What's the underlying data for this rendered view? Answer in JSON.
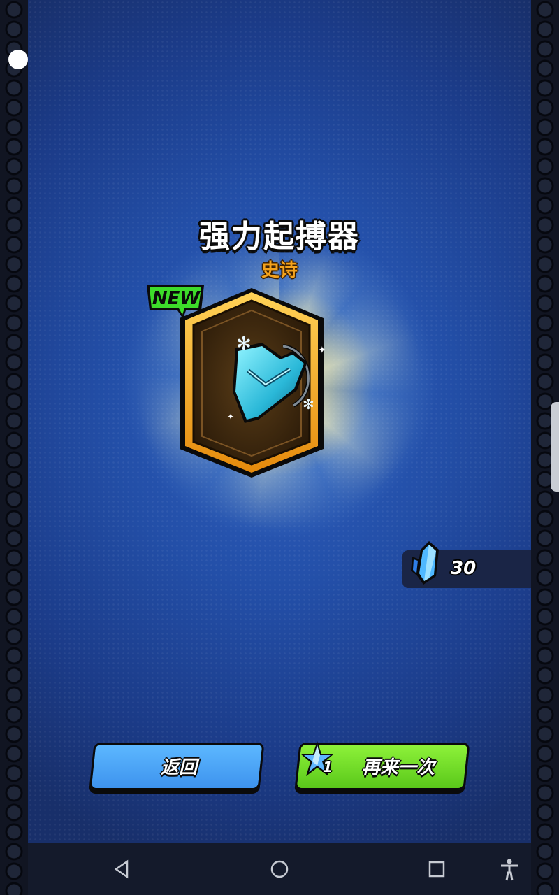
{
  "item": {
    "name": "强力起搏器",
    "rarity": "史诗",
    "badge": "NEW",
    "icon": "heart-pacemaker-icon"
  },
  "currency": {
    "icon": "blue-crystal-icon",
    "amount": "30"
  },
  "buttons": {
    "back_label": "返回",
    "again_label": "再来一次",
    "again_cost": "1",
    "again_cost_icon": "star-ticket-icon"
  },
  "colors": {
    "rarity": "#f4a21b",
    "back_button": "#4aa5f5",
    "again_button": "#72dc26",
    "badge": "#3ddc2a"
  },
  "navbar": [
    "back-nav-icon",
    "home-nav-icon",
    "recents-nav-icon",
    "accessibility-icon"
  ]
}
